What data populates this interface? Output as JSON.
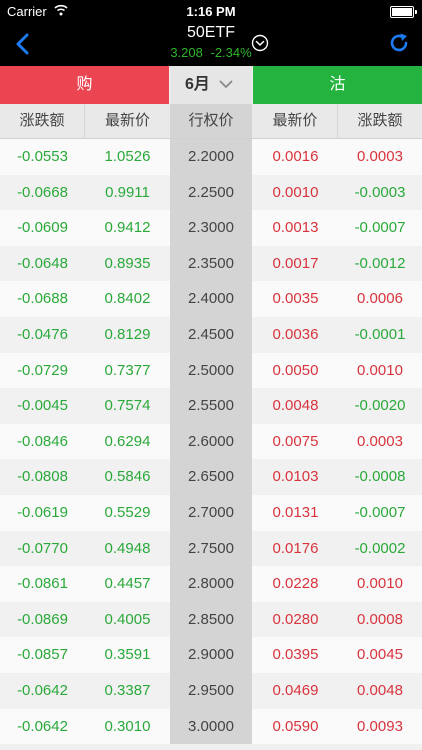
{
  "status_bar": {
    "carrier": "Carrier",
    "time": "1:16 PM"
  },
  "nav": {
    "title": "50ETF",
    "price": "3.208",
    "change_pct": "-2.34%"
  },
  "tabs": {
    "call": "购",
    "month": "6月",
    "put": "沽"
  },
  "columns": [
    "涨跌额",
    "最新价",
    "行权价",
    "最新价",
    "涨跌额"
  ],
  "colors": {
    "call_tab": "#ec4552",
    "put_tab": "#23b33e",
    "up": "#d8343d",
    "down": "#2aa93a"
  },
  "rows": [
    {
      "call_change": "-0.0553",
      "call_price": "1.0526",
      "strike": "2.2000",
      "put_price": "0.0016",
      "put_change": "0.0003"
    },
    {
      "call_change": "-0.0668",
      "call_price": "0.9911",
      "strike": "2.2500",
      "put_price": "0.0010",
      "put_change": "-0.0003"
    },
    {
      "call_change": "-0.0609",
      "call_price": "0.9412",
      "strike": "2.3000",
      "put_price": "0.0013",
      "put_change": "-0.0007"
    },
    {
      "call_change": "-0.0648",
      "call_price": "0.8935",
      "strike": "2.3500",
      "put_price": "0.0017",
      "put_change": "-0.0012"
    },
    {
      "call_change": "-0.0688",
      "call_price": "0.8402",
      "strike": "2.4000",
      "put_price": "0.0035",
      "put_change": "0.0006"
    },
    {
      "call_change": "-0.0476",
      "call_price": "0.8129",
      "strike": "2.4500",
      "put_price": "0.0036",
      "put_change": "-0.0001"
    },
    {
      "call_change": "-0.0729",
      "call_price": "0.7377",
      "strike": "2.5000",
      "put_price": "0.0050",
      "put_change": "0.0010"
    },
    {
      "call_change": "-0.0045",
      "call_price": "0.7574",
      "strike": "2.5500",
      "put_price": "0.0048",
      "put_change": "-0.0020"
    },
    {
      "call_change": "-0.0846",
      "call_price": "0.6294",
      "strike": "2.6000",
      "put_price": "0.0075",
      "put_change": "0.0003"
    },
    {
      "call_change": "-0.0808",
      "call_price": "0.5846",
      "strike": "2.6500",
      "put_price": "0.0103",
      "put_change": "-0.0008"
    },
    {
      "call_change": "-0.0619",
      "call_price": "0.5529",
      "strike": "2.7000",
      "put_price": "0.0131",
      "put_change": "-0.0007"
    },
    {
      "call_change": "-0.0770",
      "call_price": "0.4948",
      "strike": "2.7500",
      "put_price": "0.0176",
      "put_change": "-0.0002"
    },
    {
      "call_change": "-0.0861",
      "call_price": "0.4457",
      "strike": "2.8000",
      "put_price": "0.0228",
      "put_change": "0.0010"
    },
    {
      "call_change": "-0.0869",
      "call_price": "0.4005",
      "strike": "2.8500",
      "put_price": "0.0280",
      "put_change": "0.0008"
    },
    {
      "call_change": "-0.0857",
      "call_price": "0.3591",
      "strike": "2.9000",
      "put_price": "0.0395",
      "put_change": "0.0045"
    },
    {
      "call_change": "-0.0642",
      "call_price": "0.3387",
      "strike": "2.9500",
      "put_price": "0.0469",
      "put_change": "0.0048"
    },
    {
      "call_change": "-0.0642",
      "call_price": "0.3010",
      "strike": "3.0000",
      "put_price": "0.0590",
      "put_change": "0.0093"
    }
  ]
}
